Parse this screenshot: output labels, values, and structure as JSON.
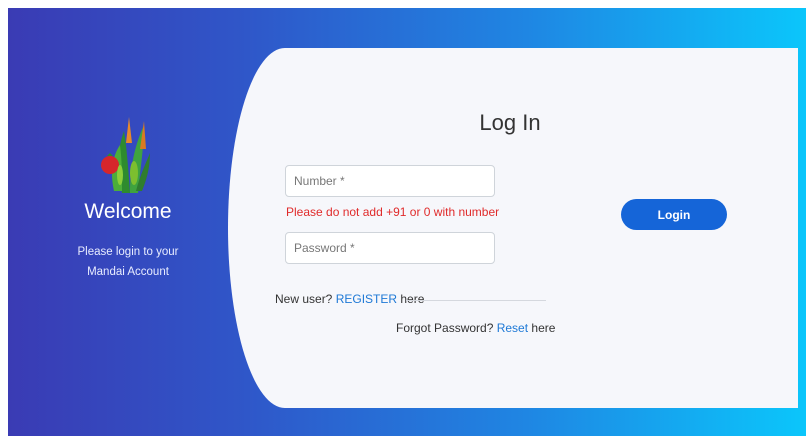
{
  "left_panel": {
    "logo_icon": "vegetables-logo-icon",
    "welcome": "Welcome",
    "subtitle_line1": "Please login to your",
    "subtitle_line2": "Mandai Account"
  },
  "form": {
    "title": "Log In",
    "number_placeholder": "Number *",
    "number_value": "",
    "number_hint": "Please do not add +91 or 0 with number",
    "password_placeholder": "Password *",
    "password_value": "",
    "login_label": "Login",
    "register_prefix": "New user? ",
    "register_link": "REGISTER",
    "register_suffix": " here",
    "forgot_prefix": "Forgot Password? ",
    "reset_link": "Reset",
    "reset_suffix": " here"
  },
  "colors": {
    "gradient_start": "#3a3bb4",
    "gradient_end": "#0bc6fb",
    "card_bg": "#f6f7fb",
    "button": "#1565d8",
    "error": "#e02b2b",
    "link": "#1e79d6"
  }
}
